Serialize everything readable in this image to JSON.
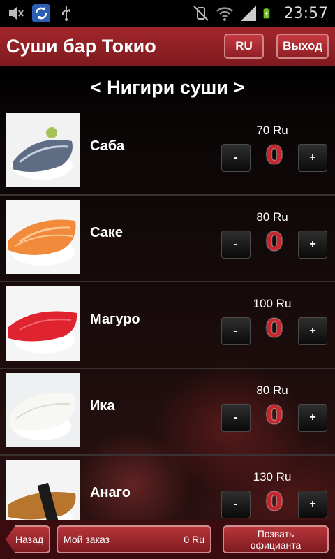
{
  "status_bar": {
    "time": "23:57",
    "icons": [
      "mute-icon",
      "sync-icon",
      "usb-icon",
      "vibrate-off-icon",
      "wifi-icon",
      "signal-icon",
      "battery-charging-icon"
    ]
  },
  "header": {
    "title": "Суши бар Токио",
    "lang_button": "RU",
    "exit_button": "Выход"
  },
  "section": {
    "title": "< Нигири суши >"
  },
  "items": [
    {
      "name": "Саба",
      "price": "70 Ru",
      "qty": "0",
      "minus": "-",
      "plus": "+"
    },
    {
      "name": "Саке",
      "price": "80 Ru",
      "qty": "0",
      "minus": "-",
      "plus": "+"
    },
    {
      "name": "Магуро",
      "price": "100 Ru",
      "qty": "0",
      "minus": "-",
      "plus": "+"
    },
    {
      "name": "Ика",
      "price": "80 Ru",
      "qty": "0",
      "minus": "-",
      "plus": "+"
    },
    {
      "name": "Анаго",
      "price": "130 Ru",
      "qty": "0",
      "minus": "-",
      "plus": "+"
    }
  ],
  "bottom_bar": {
    "back_button": "Назад",
    "order_label": "Мой заказ",
    "order_total": "0 Ru",
    "waiter_line1": "Позвать",
    "waiter_line2": "официанта"
  },
  "colors": {
    "accent": "#9c2328",
    "quantity": "#c8262c",
    "bottom_bar": "#3a0c10"
  }
}
